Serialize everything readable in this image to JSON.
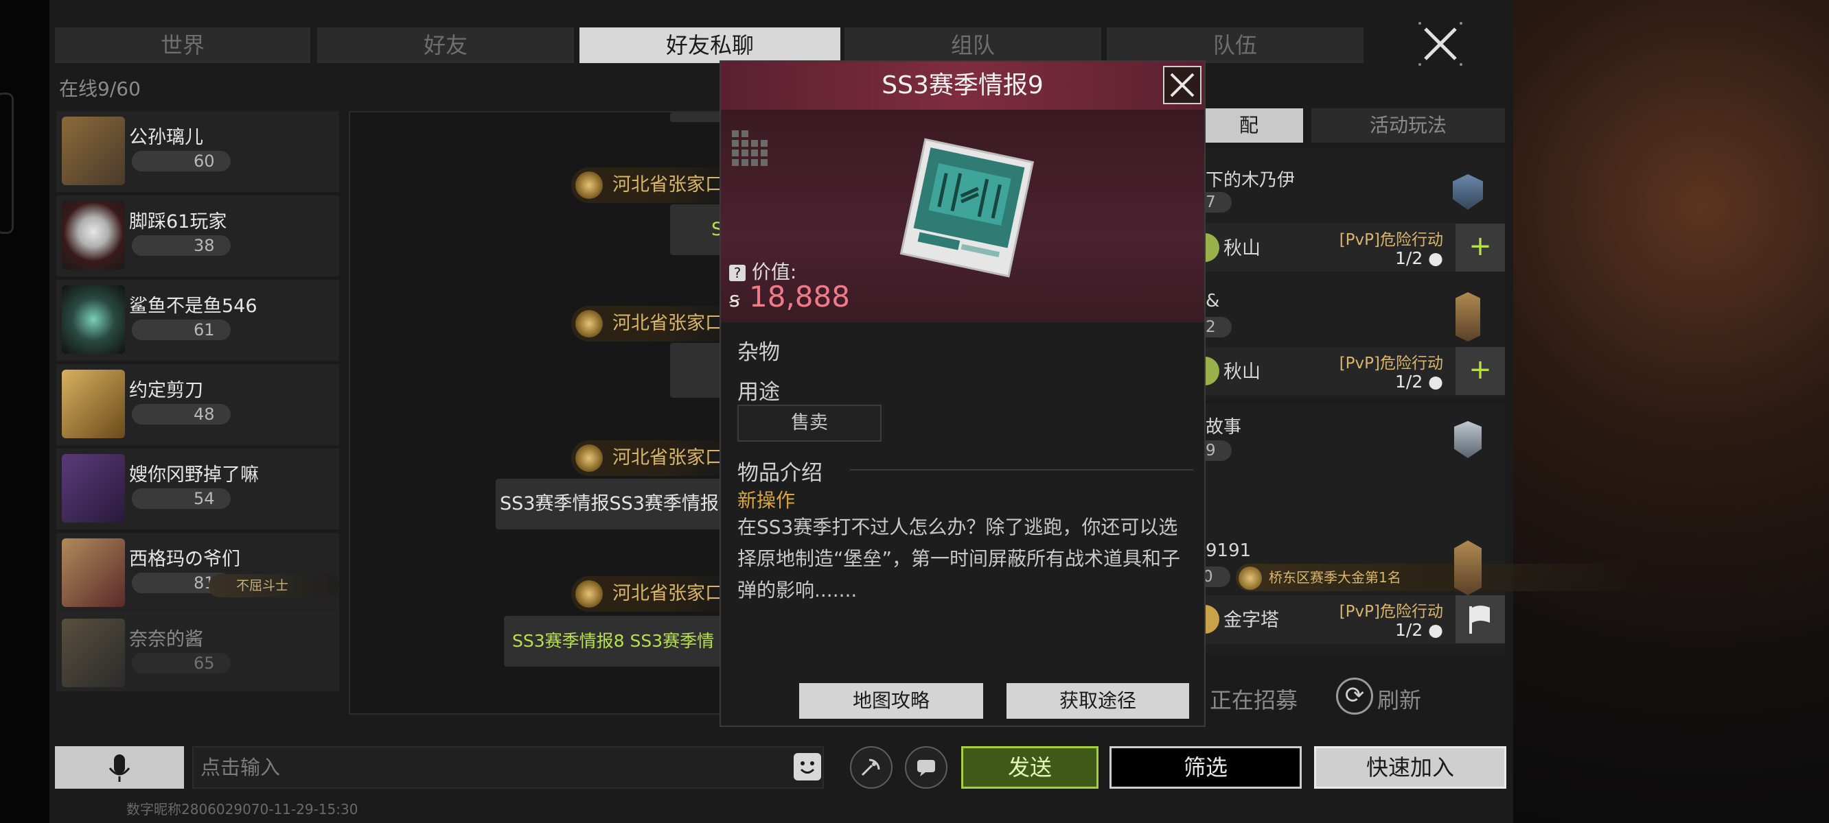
{
  "tabs": [
    "世界",
    "好友",
    "好友私聊",
    "组队",
    "队伍"
  ],
  "active_tab": "好友私聊",
  "online_count": "在线9/60",
  "friends": [
    {
      "name": "公孙璃儿",
      "level": "60"
    },
    {
      "name": "脚踩61玩家",
      "level": "38"
    },
    {
      "name": "鲨鱼不是鱼546",
      "level": "61"
    },
    {
      "name": "约定剪刀",
      "level": "48"
    },
    {
      "name": "嫂你冈野掉了嘛",
      "level": "54"
    },
    {
      "name": "西格玛の爷们",
      "level": "81",
      "title": "不屈斗士"
    },
    {
      "name": "奈奈的酱",
      "level": "65"
    }
  ],
  "chat": {
    "sender": "河北省张家口",
    "messages": [
      "S",
      "SS3赛季情报SS3赛季情报",
      "SS3赛季情报8  SS3赛季情"
    ]
  },
  "right_panel": {
    "tab_match": "配",
    "tab_activity": "活动玩法",
    "teams": [
      {
        "name": "下的木乃伊",
        "level": "7",
        "location": "秋山",
        "mode": "[PvP]危险行动",
        "count": "1/2",
        "action": "+"
      },
      {
        "name": "&",
        "level": "2",
        "location": "秋山",
        "mode": "[PvP]危险行动",
        "count": "1/2",
        "action": "+"
      },
      {
        "name": "故事",
        "level": "9"
      },
      {
        "name": "9191",
        "level": "0",
        "title": "桥东区赛季大金第1名",
        "location": "金字塔",
        "mode": "[PvP]危险行动",
        "count": "1/2"
      }
    ],
    "recruiting": "正在招募",
    "refresh": "刷新"
  },
  "modal": {
    "title": "SS3赛季情报9",
    "value_label": "价值:",
    "value": "18,888",
    "category": "杂物",
    "usage_label": "用途",
    "sell": "售卖",
    "desc_header": "物品介绍",
    "desc_subtitle": "新操作",
    "desc_text": "在SS3赛季打不过人怎么办？除了逃跑，你还可以选择原地制造“堡垒”，第一时间屏蔽所有战术道具和子弹的影响.......",
    "map_guide": "地图攻略",
    "obtain": "获取途径"
  },
  "bottom": {
    "input_placeholder": "点击输入",
    "send": "发送",
    "filter": "筛选",
    "quick_join": "快速加入"
  },
  "watermark": "数字昵称2806029070-11-29-15:30",
  "colors": {
    "accent_green": "#a4d13a",
    "modal_header": "#7e2d3f",
    "value_pink": "#f07b88",
    "gold": "#d9b66b"
  }
}
